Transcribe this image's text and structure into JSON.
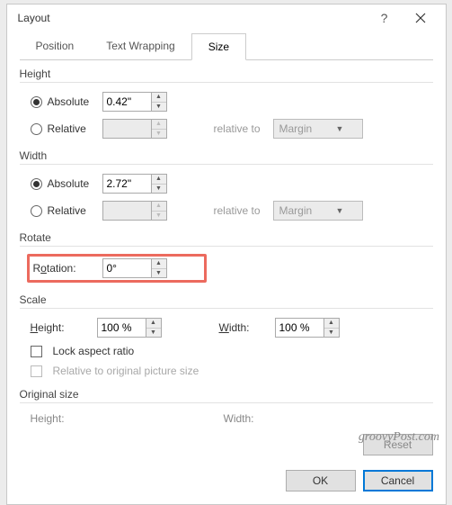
{
  "window": {
    "title": "Layout"
  },
  "tabs": {
    "position": "Position",
    "text_wrapping": "Text Wrapping",
    "size": "Size"
  },
  "height": {
    "group": "Height",
    "absolute_label": "Absolute",
    "absolute_value": "0.42\"",
    "relative_label": "Relative",
    "relative_value": "",
    "relative_to_label": "relative to",
    "relative_to_value": "Margin"
  },
  "width": {
    "group": "Width",
    "absolute_label": "Absolute",
    "absolute_value": "2.72\"",
    "relative_label": "Relative",
    "relative_value": "",
    "relative_to_label": "relative to",
    "relative_to_value": "Margin"
  },
  "rotate": {
    "group": "Rotate",
    "rotation_label": "Rotation:",
    "rotation_value": "0°"
  },
  "scale": {
    "group": "Scale",
    "height_label": "Height:",
    "height_value": "100 %",
    "width_label": "Width:",
    "width_value": "100 %",
    "lock_aspect": "Lock aspect ratio",
    "relative_original": "Relative to original picture size"
  },
  "original": {
    "group": "Original size",
    "height_label": "Height:",
    "width_label": "Width:"
  },
  "buttons": {
    "reset": "Reset",
    "ok": "OK",
    "cancel": "Cancel"
  },
  "watermark": "groovyPost.com"
}
